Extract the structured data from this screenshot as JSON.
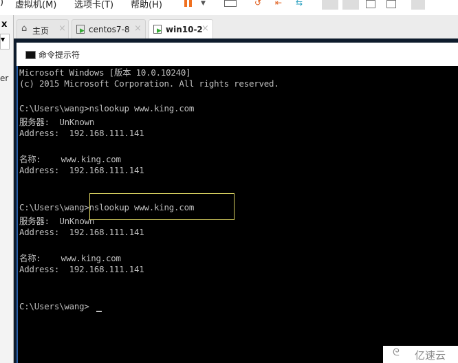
{
  "menu": {
    "items": [
      "虚拟机(M)",
      "选项卡(T)",
      "帮助(H)"
    ]
  },
  "left_panel": {
    "close": "x",
    "partial_text": "er"
  },
  "tabs": [
    {
      "label": "主页",
      "icon": "home-icon"
    },
    {
      "label": "centos7-8",
      "icon": "vm-icon"
    },
    {
      "label": "win10-2",
      "icon": "vm-icon",
      "active": true
    }
  ],
  "tab_close": "×",
  "window": {
    "title": "命令提示符"
  },
  "console": {
    "lines": [
      "Microsoft Windows [版本 10.0.10240]",
      "(c) 2015 Microsoft Corporation. All rights reserved.",
      "",
      "C:\\Users\\wang>nslookup www.king.com",
      "服务器:  UnKnown",
      "Address:  192.168.111.141",
      "",
      "名称:    www.king.com",
      "Address:  192.168.111.141",
      "",
      "",
      "C:\\Users\\wang>nslookup www.king.com",
      "服务器:  UnKnown",
      "Address:  192.168.111.141",
      "",
      "名称:    www.king.com",
      "Address:  192.168.111.141",
      "",
      "",
      "C:\\Users\\wang>"
    ]
  },
  "watermark": "亿速云"
}
